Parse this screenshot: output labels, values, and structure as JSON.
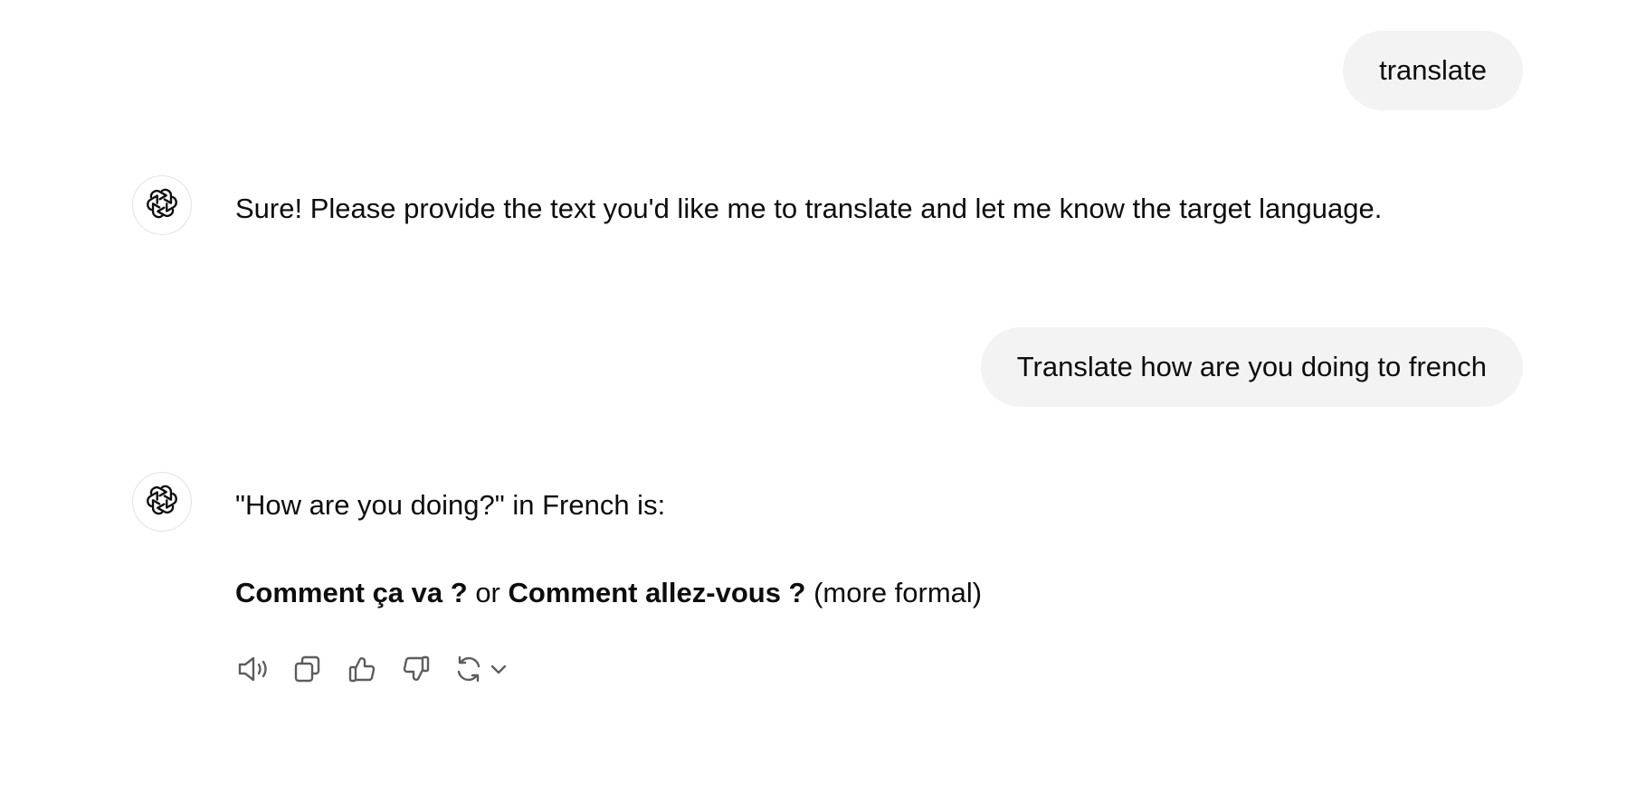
{
  "conversation": {
    "user_message_1": "translate",
    "assistant_reply_1": "Sure! Please provide the text you'd like me to translate and let me know the target language.",
    "user_message_2": "Translate how are you doing to french",
    "assistant_reply_2": {
      "line1": "\"How are you doing?\" in French is:",
      "phrase_informal": "Comment ça va ?",
      "connector": " or ",
      "phrase_formal": "Comment allez-vous ?",
      "formal_note": " (more formal)"
    }
  },
  "assistant": {
    "avatar_icon": "openai-logo-icon"
  },
  "message_actions": [
    {
      "name": "read-aloud-button",
      "icon": "speaker-icon"
    },
    {
      "name": "copy-button",
      "icon": "copy-icon"
    },
    {
      "name": "thumbs-up-button",
      "icon": "thumbs-up-icon"
    },
    {
      "name": "thumbs-down-button",
      "icon": "thumbs-down-icon"
    },
    {
      "name": "regenerate-button",
      "icon": "refresh-icon"
    }
  ],
  "colors": {
    "user_bubble_bg": "#f3f3f3",
    "text": "#0d0d0d",
    "icon": "#5d5d5d"
  }
}
